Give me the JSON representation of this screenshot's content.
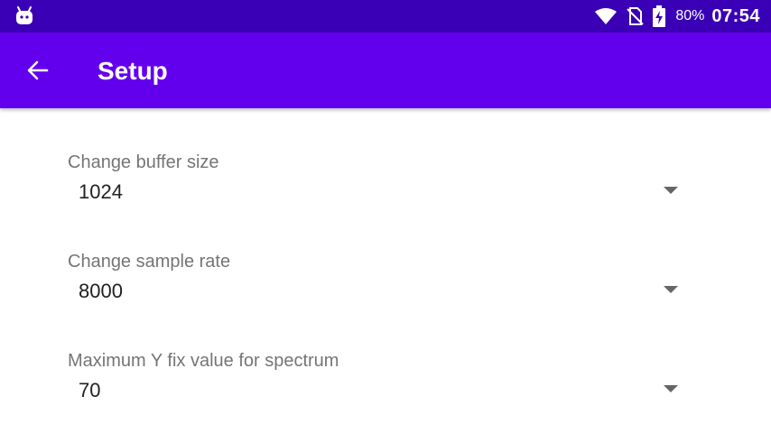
{
  "status_bar": {
    "battery_percent": "80%",
    "time": "07:54",
    "icons": [
      "android-notification-icon",
      "wifi-icon",
      "no-sim-icon",
      "battery-charging-icon"
    ]
  },
  "app_bar": {
    "title": "Setup",
    "back_icon": "arrow-back-icon"
  },
  "settings": [
    {
      "label": "Change buffer size",
      "value": "1024"
    },
    {
      "label": "Change sample rate",
      "value": "8000"
    },
    {
      "label": "Maximum Y fix value for spectrum",
      "value": "70"
    }
  ],
  "colors": {
    "status_bar": "#3a00b5",
    "app_bar": "#6200ee",
    "label_text": "#757575",
    "value_text": "#212121",
    "dropdown_arrow": "#666666"
  }
}
